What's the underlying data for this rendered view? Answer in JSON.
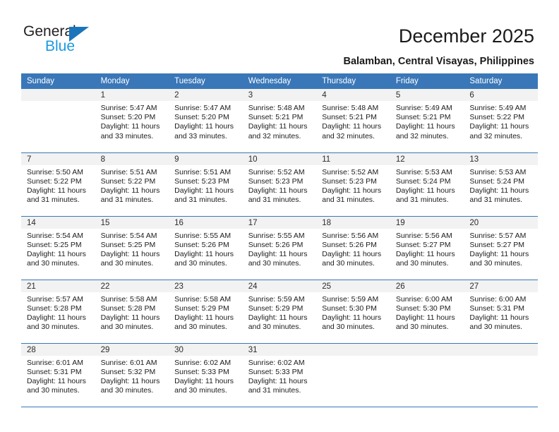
{
  "brand": {
    "name_top": "General",
    "name_bottom": "Blue",
    "triangle_color": "#1b75bb",
    "top_color": "#231f20",
    "bottom_color": "#1b9ae0"
  },
  "header": {
    "title": "December 2025",
    "subtitle": "Balamban, Central Visayas, Philippines"
  },
  "theme": {
    "header_bg": "#3a77b8",
    "daynum_bg": "#f2f2f2",
    "grid_line": "#3a77b8",
    "text": "#1c1c1c"
  },
  "weekdays": [
    "Sunday",
    "Monday",
    "Tuesday",
    "Wednesday",
    "Thursday",
    "Friday",
    "Saturday"
  ],
  "labels": {
    "sunrise_prefix": "Sunrise:",
    "sunset_prefix": "Sunset:",
    "daylight_prefix": "Daylight:"
  },
  "weeks": [
    [
      {
        "day": "",
        "sunrise": "",
        "sunset": "",
        "daylight_line1": "",
        "daylight_line2": ""
      },
      {
        "day": "1",
        "sunrise": "Sunrise: 5:47 AM",
        "sunset": "Sunset: 5:20 PM",
        "daylight_line1": "Daylight: 11 hours",
        "daylight_line2": "and 33 minutes."
      },
      {
        "day": "2",
        "sunrise": "Sunrise: 5:47 AM",
        "sunset": "Sunset: 5:20 PM",
        "daylight_line1": "Daylight: 11 hours",
        "daylight_line2": "and 33 minutes."
      },
      {
        "day": "3",
        "sunrise": "Sunrise: 5:48 AM",
        "sunset": "Sunset: 5:21 PM",
        "daylight_line1": "Daylight: 11 hours",
        "daylight_line2": "and 32 minutes."
      },
      {
        "day": "4",
        "sunrise": "Sunrise: 5:48 AM",
        "sunset": "Sunset: 5:21 PM",
        "daylight_line1": "Daylight: 11 hours",
        "daylight_line2": "and 32 minutes."
      },
      {
        "day": "5",
        "sunrise": "Sunrise: 5:49 AM",
        "sunset": "Sunset: 5:21 PM",
        "daylight_line1": "Daylight: 11 hours",
        "daylight_line2": "and 32 minutes."
      },
      {
        "day": "6",
        "sunrise": "Sunrise: 5:49 AM",
        "sunset": "Sunset: 5:22 PM",
        "daylight_line1": "Daylight: 11 hours",
        "daylight_line2": "and 32 minutes."
      }
    ],
    [
      {
        "day": "7",
        "sunrise": "Sunrise: 5:50 AM",
        "sunset": "Sunset: 5:22 PM",
        "daylight_line1": "Daylight: 11 hours",
        "daylight_line2": "and 31 minutes."
      },
      {
        "day": "8",
        "sunrise": "Sunrise: 5:51 AM",
        "sunset": "Sunset: 5:22 PM",
        "daylight_line1": "Daylight: 11 hours",
        "daylight_line2": "and 31 minutes."
      },
      {
        "day": "9",
        "sunrise": "Sunrise: 5:51 AM",
        "sunset": "Sunset: 5:23 PM",
        "daylight_line1": "Daylight: 11 hours",
        "daylight_line2": "and 31 minutes."
      },
      {
        "day": "10",
        "sunrise": "Sunrise: 5:52 AM",
        "sunset": "Sunset: 5:23 PM",
        "daylight_line1": "Daylight: 11 hours",
        "daylight_line2": "and 31 minutes."
      },
      {
        "day": "11",
        "sunrise": "Sunrise: 5:52 AM",
        "sunset": "Sunset: 5:23 PM",
        "daylight_line1": "Daylight: 11 hours",
        "daylight_line2": "and 31 minutes."
      },
      {
        "day": "12",
        "sunrise": "Sunrise: 5:53 AM",
        "sunset": "Sunset: 5:24 PM",
        "daylight_line1": "Daylight: 11 hours",
        "daylight_line2": "and 31 minutes."
      },
      {
        "day": "13",
        "sunrise": "Sunrise: 5:53 AM",
        "sunset": "Sunset: 5:24 PM",
        "daylight_line1": "Daylight: 11 hours",
        "daylight_line2": "and 31 minutes."
      }
    ],
    [
      {
        "day": "14",
        "sunrise": "Sunrise: 5:54 AM",
        "sunset": "Sunset: 5:25 PM",
        "daylight_line1": "Daylight: 11 hours",
        "daylight_line2": "and 30 minutes."
      },
      {
        "day": "15",
        "sunrise": "Sunrise: 5:54 AM",
        "sunset": "Sunset: 5:25 PM",
        "daylight_line1": "Daylight: 11 hours",
        "daylight_line2": "and 30 minutes."
      },
      {
        "day": "16",
        "sunrise": "Sunrise: 5:55 AM",
        "sunset": "Sunset: 5:26 PM",
        "daylight_line1": "Daylight: 11 hours",
        "daylight_line2": "and 30 minutes."
      },
      {
        "day": "17",
        "sunrise": "Sunrise: 5:55 AM",
        "sunset": "Sunset: 5:26 PM",
        "daylight_line1": "Daylight: 11 hours",
        "daylight_line2": "and 30 minutes."
      },
      {
        "day": "18",
        "sunrise": "Sunrise: 5:56 AM",
        "sunset": "Sunset: 5:26 PM",
        "daylight_line1": "Daylight: 11 hours",
        "daylight_line2": "and 30 minutes."
      },
      {
        "day": "19",
        "sunrise": "Sunrise: 5:56 AM",
        "sunset": "Sunset: 5:27 PM",
        "daylight_line1": "Daylight: 11 hours",
        "daylight_line2": "and 30 minutes."
      },
      {
        "day": "20",
        "sunrise": "Sunrise: 5:57 AM",
        "sunset": "Sunset: 5:27 PM",
        "daylight_line1": "Daylight: 11 hours",
        "daylight_line2": "and 30 minutes."
      }
    ],
    [
      {
        "day": "21",
        "sunrise": "Sunrise: 5:57 AM",
        "sunset": "Sunset: 5:28 PM",
        "daylight_line1": "Daylight: 11 hours",
        "daylight_line2": "and 30 minutes."
      },
      {
        "day": "22",
        "sunrise": "Sunrise: 5:58 AM",
        "sunset": "Sunset: 5:28 PM",
        "daylight_line1": "Daylight: 11 hours",
        "daylight_line2": "and 30 minutes."
      },
      {
        "day": "23",
        "sunrise": "Sunrise: 5:58 AM",
        "sunset": "Sunset: 5:29 PM",
        "daylight_line1": "Daylight: 11 hours",
        "daylight_line2": "and 30 minutes."
      },
      {
        "day": "24",
        "sunrise": "Sunrise: 5:59 AM",
        "sunset": "Sunset: 5:29 PM",
        "daylight_line1": "Daylight: 11 hours",
        "daylight_line2": "and 30 minutes."
      },
      {
        "day": "25",
        "sunrise": "Sunrise: 5:59 AM",
        "sunset": "Sunset: 5:30 PM",
        "daylight_line1": "Daylight: 11 hours",
        "daylight_line2": "and 30 minutes."
      },
      {
        "day": "26",
        "sunrise": "Sunrise: 6:00 AM",
        "sunset": "Sunset: 5:30 PM",
        "daylight_line1": "Daylight: 11 hours",
        "daylight_line2": "and 30 minutes."
      },
      {
        "day": "27",
        "sunrise": "Sunrise: 6:00 AM",
        "sunset": "Sunset: 5:31 PM",
        "daylight_line1": "Daylight: 11 hours",
        "daylight_line2": "and 30 minutes."
      }
    ],
    [
      {
        "day": "28",
        "sunrise": "Sunrise: 6:01 AM",
        "sunset": "Sunset: 5:31 PM",
        "daylight_line1": "Daylight: 11 hours",
        "daylight_line2": "and 30 minutes."
      },
      {
        "day": "29",
        "sunrise": "Sunrise: 6:01 AM",
        "sunset": "Sunset: 5:32 PM",
        "daylight_line1": "Daylight: 11 hours",
        "daylight_line2": "and 30 minutes."
      },
      {
        "day": "30",
        "sunrise": "Sunrise: 6:02 AM",
        "sunset": "Sunset: 5:33 PM",
        "daylight_line1": "Daylight: 11 hours",
        "daylight_line2": "and 30 minutes."
      },
      {
        "day": "31",
        "sunrise": "Sunrise: 6:02 AM",
        "sunset": "Sunset: 5:33 PM",
        "daylight_line1": "Daylight: 11 hours",
        "daylight_line2": "and 31 minutes."
      },
      {
        "day": "",
        "sunrise": "",
        "sunset": "",
        "daylight_line1": "",
        "daylight_line2": ""
      },
      {
        "day": "",
        "sunrise": "",
        "sunset": "",
        "daylight_line1": "",
        "daylight_line2": ""
      },
      {
        "day": "",
        "sunrise": "",
        "sunset": "",
        "daylight_line1": "",
        "daylight_line2": ""
      }
    ]
  ]
}
